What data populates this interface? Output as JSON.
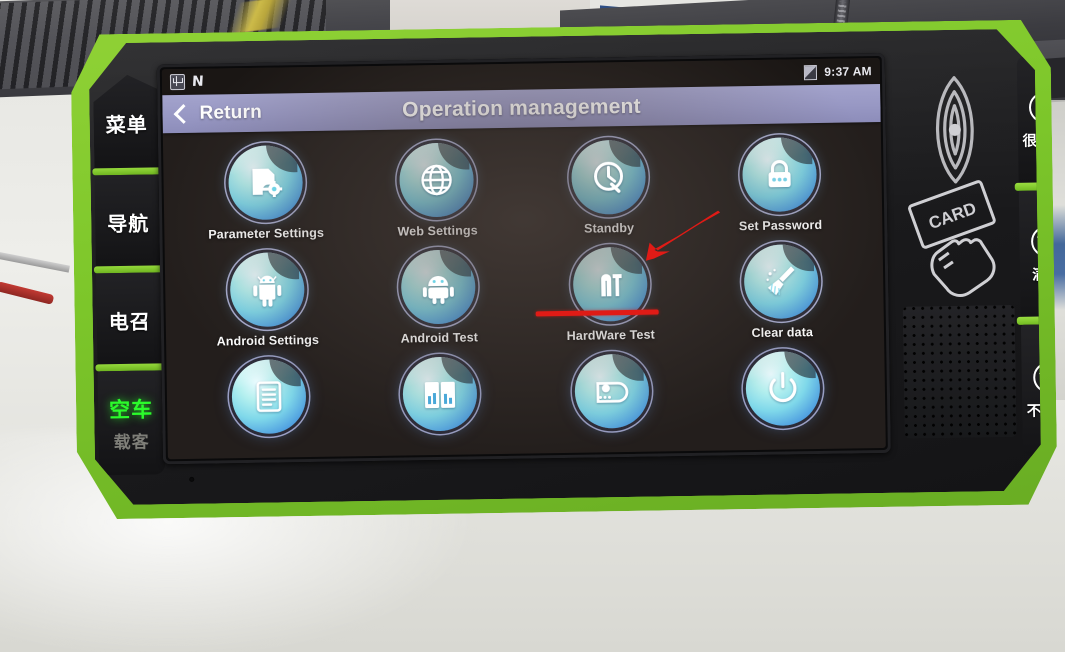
{
  "device": {
    "bezel_color": "#7cc62a",
    "body_color": "#1b1b1d",
    "left_keys": [
      {
        "label": "菜单",
        "name": "menu"
      },
      {
        "label": "导航",
        "name": "navigation"
      },
      {
        "label": "电召",
        "name": "dispatch"
      }
    ],
    "status_key": {
      "active_label": "空车",
      "active_color": "#2bfb2b",
      "inactive_label": "载客",
      "inactive_color": "#7e7e78"
    },
    "right_keys": [
      {
        "label": "很满意",
        "icon": "face-smile-icon",
        "name": "very-satisfied"
      },
      {
        "label": "满意",
        "icon": "face-neutral-smile-icon",
        "name": "satisfied"
      },
      {
        "label": "不满意",
        "icon": "face-frown-icon",
        "name": "dissatisfied"
      }
    ],
    "nfc_reader": {
      "card_label": "CARD",
      "waves_icon": "nfc-waves-icon",
      "hand_icon": "hand-holding-card-icon"
    }
  },
  "statusbar": {
    "usb_icon": "usb-icon",
    "nfc_icon": "nfc-n-icon",
    "signal_icon": "signal-icon",
    "time": "9:37 AM"
  },
  "titlebar": {
    "back_label": "Return",
    "back_icon": "chevron-left-icon",
    "title": "Operation management",
    "bar_color": "#9898c4"
  },
  "grid": {
    "rows": [
      [
        {
          "label": "Parameter Settings",
          "icon": "document-gear-icon",
          "name": "parameter-settings"
        },
        {
          "label": "Web Settings",
          "icon": "globe-icon",
          "name": "web-settings"
        },
        {
          "label": "Standby",
          "icon": "standby-clock-icon",
          "name": "standby"
        },
        {
          "label": "Set Password",
          "icon": "padlock-icon",
          "name": "set-password"
        }
      ],
      [
        {
          "label": "Android Settings",
          "icon": "android-robot-icon",
          "name": "android-settings"
        },
        {
          "label": "Android Test",
          "icon": "android-head-icon",
          "name": "android-test"
        },
        {
          "label": "HardWare Test",
          "icon": "hardware-tools-icon",
          "name": "hardware-test"
        },
        {
          "label": "Clear data",
          "icon": "broom-icon",
          "name": "clear-data"
        }
      ],
      [
        {
          "label": "",
          "icon": "list-document-icon",
          "name": "app-row3-1"
        },
        {
          "label": "",
          "icon": "book-chart-icon",
          "name": "app-row3-2"
        },
        {
          "label": "",
          "icon": "settings-tag-icon",
          "name": "app-row3-3"
        },
        {
          "label": "",
          "icon": "power-icon",
          "name": "app-row3-4"
        }
      ]
    ]
  },
  "annotations": {
    "arrow_color": "#e01b16",
    "arrow_target": "Web Settings",
    "underline_color": "#e01b16",
    "underline_target": "Web Settings"
  }
}
